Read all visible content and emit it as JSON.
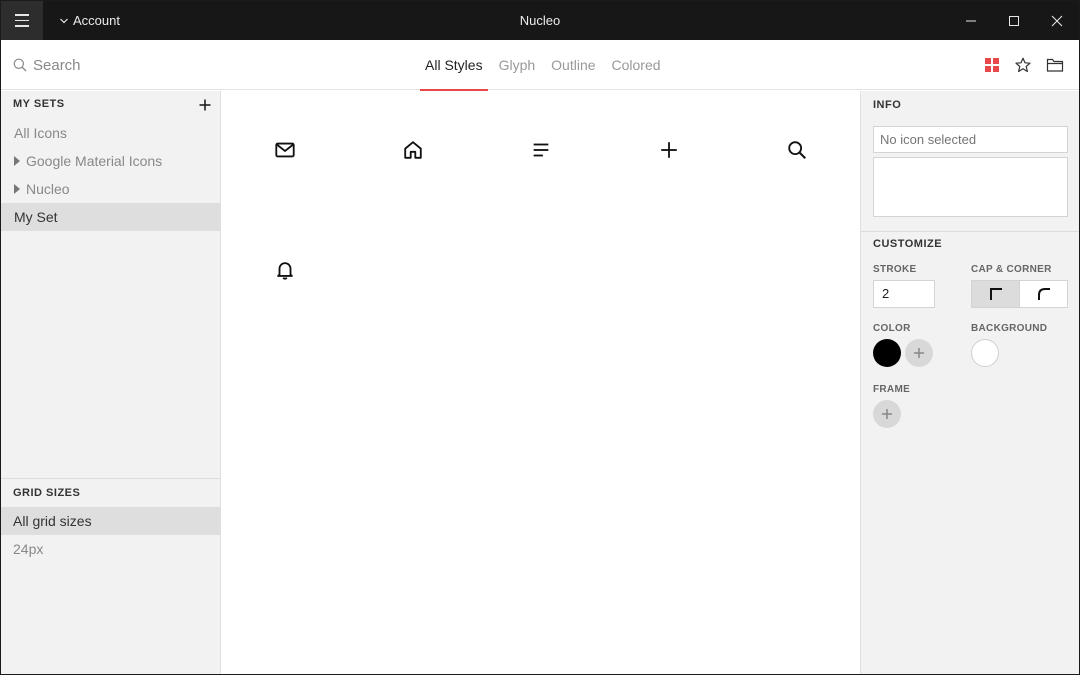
{
  "window": {
    "title": "Nucleo",
    "account_label": "Account",
    "controls": [
      "minimize-icon",
      "maximize-icon",
      "close-icon"
    ]
  },
  "toolbar": {
    "search_placeholder": "Search",
    "tabs": [
      {
        "label": "All Styles",
        "active": true
      },
      {
        "label": "Glyph",
        "active": false
      },
      {
        "label": "Outline",
        "active": false
      },
      {
        "label": "Colored",
        "active": false
      }
    ],
    "right_icons": [
      "grid-view-icon",
      "star-icon",
      "folder-icon"
    ],
    "accent_color": "#e8474c"
  },
  "sidebar": {
    "sets_heading": "MY SETS",
    "sets": [
      {
        "label": "All Icons",
        "expandable": false,
        "selected": false
      },
      {
        "label": "Google Material Icons",
        "expandable": true,
        "selected": false
      },
      {
        "label": "Nucleo",
        "expandable": true,
        "selected": false
      },
      {
        "label": "My Set",
        "expandable": false,
        "selected": true
      }
    ],
    "grid_heading": "GRID SIZES",
    "grid_sizes": [
      {
        "label": "All grid sizes",
        "selected": true
      },
      {
        "label": "24px",
        "selected": false
      }
    ]
  },
  "icons": [
    "mail-icon",
    "home-icon",
    "menu-lines-icon",
    "plus-icon",
    "search-icon",
    "bell-icon"
  ],
  "info": {
    "heading": "INFO",
    "name_placeholder": "No icon selected"
  },
  "customize": {
    "heading": "CUSTOMIZE",
    "stroke_label": "STROKE",
    "stroke_value": "2",
    "cap_corner_label": "CAP & CORNER",
    "cap_corner_options": [
      "square-corner-icon",
      "round-corner-icon"
    ],
    "color_label": "COLOR",
    "color_value": "#000000",
    "background_label": "BACKGROUND",
    "background_value": "#ffffff",
    "frame_label": "FRAME"
  }
}
